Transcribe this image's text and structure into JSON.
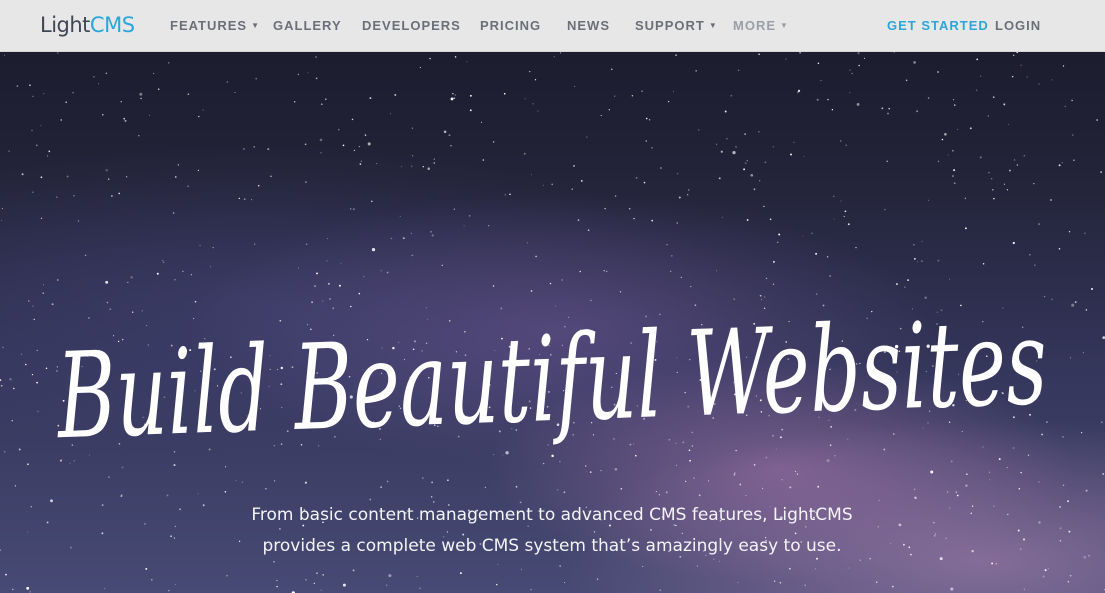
{
  "brand": {
    "light": "Light",
    "cms": "CMS"
  },
  "nav": {
    "features": "FEATURES",
    "gallery": "GALLERY",
    "developers": "DEVELOPERS",
    "pricing": "PRICING",
    "news": "NEWS",
    "support": "SUPPORT",
    "more": "MORE",
    "get_started": "GET STARTED",
    "login": "LOGIN"
  },
  "hero": {
    "headline": "Build Beautiful Websites",
    "subtitle_line1": "From basic content management to advanced CMS features, LightCMS",
    "subtitle_line2": "provides a complete web CMS system that’s amazingly easy to use."
  },
  "colors": {
    "accent": "#2aa6da",
    "nav_background": "#e7e7e7",
    "nav_text": "#6a6f78"
  },
  "icons": {
    "dropdown": "caret-down-icon"
  }
}
